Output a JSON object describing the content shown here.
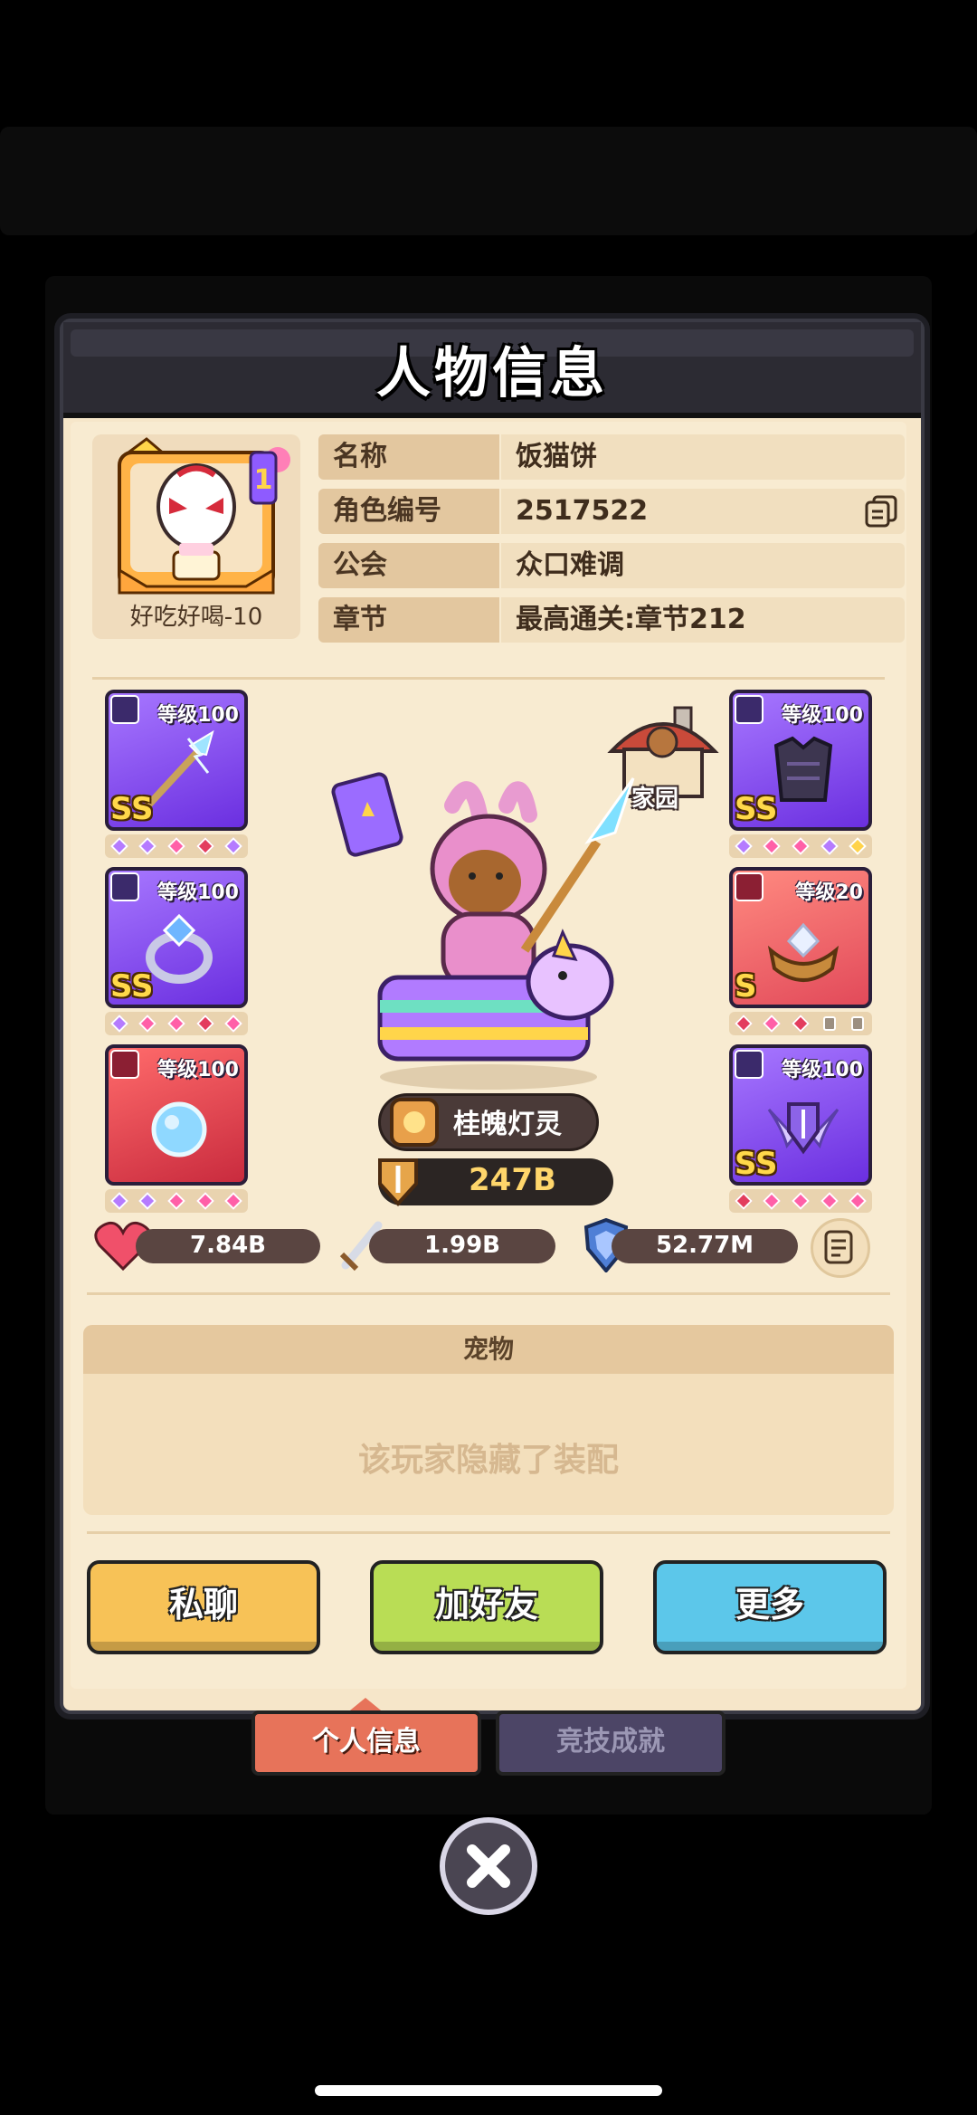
{
  "dialog": {
    "title": "人物信息"
  },
  "profile": {
    "avatar_name": "好吃好喝-10",
    "avatar_rank": "1",
    "rows": [
      {
        "key": "名称",
        "value": "饭猫饼"
      },
      {
        "key": "角色编号",
        "value": "2517522"
      },
      {
        "key": "公会",
        "value": "众口难调"
      },
      {
        "key": "章节",
        "value": "最高通关:章节212"
      }
    ]
  },
  "equipment": {
    "left": [
      {
        "level": "等级100",
        "grade": "SS",
        "slot": "weapon",
        "color": "purple",
        "gems": [
          "p",
          "p",
          "k",
          "r",
          "p"
        ]
      },
      {
        "level": "等级100",
        "grade": "SS",
        "slot": "ring",
        "color": "purple",
        "gems": [
          "p",
          "k",
          "k",
          "r",
          "k"
        ]
      },
      {
        "level": "等级100",
        "grade": "",
        "slot": "necklace",
        "color": "red",
        "gems": [
          "p",
          "p",
          "k",
          "k",
          "k"
        ]
      }
    ],
    "right": [
      {
        "level": "等级100",
        "grade": "SS",
        "slot": "armor",
        "color": "purple",
        "gems": [
          "p",
          "k",
          "k",
          "p",
          "y"
        ]
      },
      {
        "level": "等级20",
        "grade": "S",
        "slot": "belt",
        "color": "orange",
        "gems": [
          "r",
          "k",
          "r",
          "lock",
          "lock"
        ]
      },
      {
        "level": "等级100",
        "grade": "SS",
        "slot": "shield",
        "color": "purple",
        "gems": [
          "r",
          "k",
          "k",
          "k",
          "k"
        ]
      }
    ]
  },
  "home_label": "家园",
  "pet": {
    "name": "桂魄灯灵",
    "power": "247B"
  },
  "stats": {
    "hp": "7.84B",
    "attack": "1.99B",
    "defense": "52.77M"
  },
  "pet_section": {
    "header": "宠物",
    "hidden_text": "该玩家隐藏了装配"
  },
  "buttons": {
    "chat": "私聊",
    "add_friend": "加好友",
    "more": "更多"
  },
  "tabs": {
    "personal": "个人信息",
    "arena": "竞技成就"
  },
  "colors": {
    "accent": "#e7735a",
    "panel": "#f8ebd1",
    "header": "#2c2b33"
  }
}
